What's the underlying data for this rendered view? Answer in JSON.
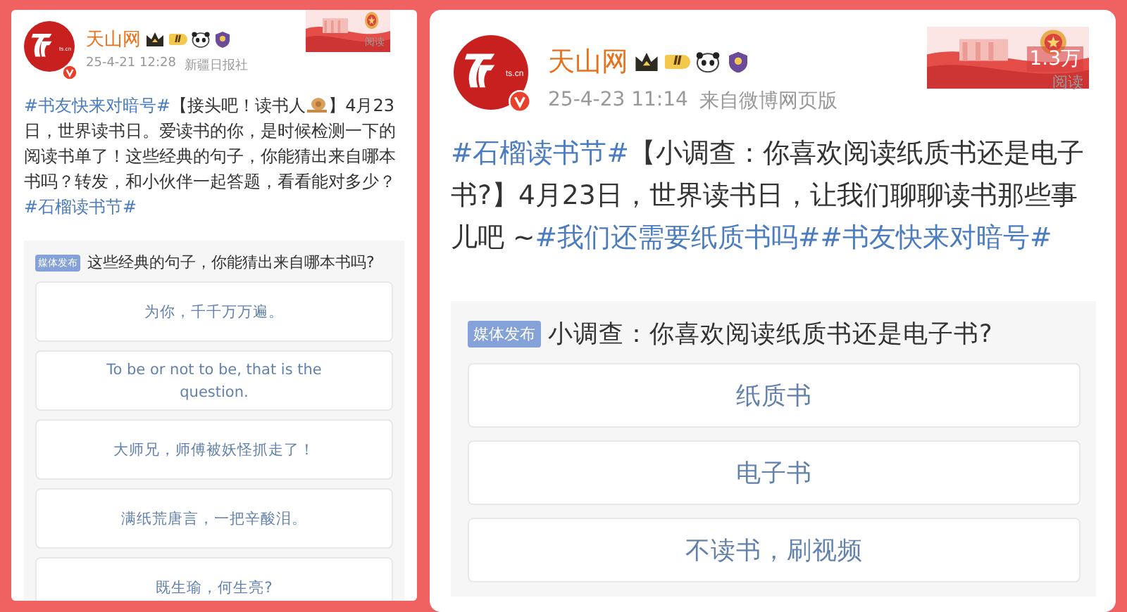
{
  "posts": [
    {
      "author": {
        "name": "天山网",
        "logo_text": "ts.cn",
        "level": "Ⅱ"
      },
      "time": "25-4-21 12:28",
      "source": "新疆日报社",
      "reads": {
        "label": "阅读"
      },
      "body": [
        {
          "kind": "topic",
          "text": "#书友快来对暗号#"
        },
        {
          "kind": "text",
          "text": "【接头吧！读书人"
        },
        {
          "kind": "emoji"
        },
        {
          "kind": "text",
          "text": "】4月23日，世界读书日。爱读书的你，是时候检测一下的阅读书单了！这些经典的句子，你能猜出来自哪本书吗？转发，和小伙伴一起答题，看看能对多少？"
        },
        {
          "kind": "topic",
          "text": "#石榴读书节#"
        }
      ],
      "poll": {
        "badge": "媒体发布",
        "question": "这些经典的句子，你能猜出来自哪本书吗?",
        "options": [
          "为你，千千万万遍。",
          "To be or not to be, that is the question.",
          "大师兄，师傅被妖怪抓走了！",
          "满纸荒唐言，一把辛酸泪。",
          "既生瑜，何生亮?"
        ]
      }
    },
    {
      "author": {
        "name": "天山网",
        "logo_text": "ts.cn",
        "level": "Ⅱ"
      },
      "time": "25-4-23 11:14",
      "source": "来自微博网页版",
      "reads": {
        "count": "1.3万",
        "label": "阅读"
      },
      "body": [
        {
          "kind": "topic",
          "text": "#石榴读书节#"
        },
        {
          "kind": "text",
          "text": "【小调查：你喜欢阅读纸质书还是电子书?】4月23日，世界读书日，让我们聊聊读书那些事儿吧 ~"
        },
        {
          "kind": "topic",
          "text": "#我们还需要纸质书吗#"
        },
        {
          "kind": "topic",
          "text": "#书友快来对暗号#"
        }
      ],
      "poll": {
        "badge": "媒体发布",
        "question": "小调查：你喜欢阅读纸质书还是电子书?",
        "options": [
          "纸质书",
          "电子书",
          "不读书，刷视频"
        ]
      }
    }
  ]
}
